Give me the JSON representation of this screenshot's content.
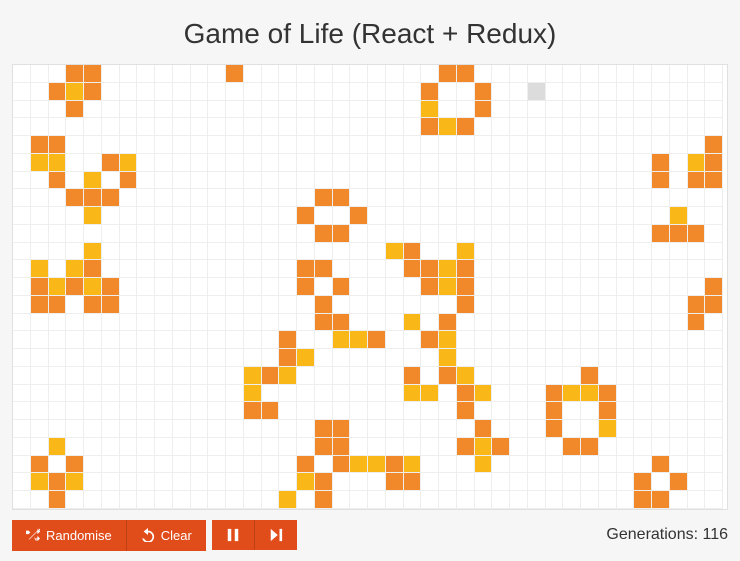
{
  "title": "Game of Life (React + Redux)",
  "controls": {
    "randomise_label": "Randomise",
    "clear_label": "Clear",
    "generations_label": "Generations:",
    "generations_value": 116
  },
  "grid": {
    "cols": 40,
    "rows": 25,
    "cell_size": 17.75,
    "cells": [
      {
        "r": 0,
        "c": 3,
        "s": "o"
      },
      {
        "r": 0,
        "c": 4,
        "s": "o"
      },
      {
        "r": 0,
        "c": 12,
        "s": "o"
      },
      {
        "r": 0,
        "c": 24,
        "s": "o"
      },
      {
        "r": 0,
        "c": 25,
        "s": "o"
      },
      {
        "r": 1,
        "c": 2,
        "s": "o"
      },
      {
        "r": 1,
        "c": 3,
        "s": "y"
      },
      {
        "r": 1,
        "c": 4,
        "s": "o"
      },
      {
        "r": 1,
        "c": 23,
        "s": "o"
      },
      {
        "r": 1,
        "c": 26,
        "s": "o"
      },
      {
        "r": 1,
        "c": 29,
        "s": "g"
      },
      {
        "r": 2,
        "c": 3,
        "s": "o"
      },
      {
        "r": 2,
        "c": 23,
        "s": "y"
      },
      {
        "r": 2,
        "c": 26,
        "s": "o"
      },
      {
        "r": 3,
        "c": 23,
        "s": "o"
      },
      {
        "r": 3,
        "c": 24,
        "s": "y"
      },
      {
        "r": 3,
        "c": 25,
        "s": "o"
      },
      {
        "r": 4,
        "c": 1,
        "s": "o"
      },
      {
        "r": 4,
        "c": 2,
        "s": "o"
      },
      {
        "r": 4,
        "c": 39,
        "s": "o"
      },
      {
        "r": 5,
        "c": 1,
        "s": "y"
      },
      {
        "r": 5,
        "c": 2,
        "s": "y"
      },
      {
        "r": 5,
        "c": 5,
        "s": "o"
      },
      {
        "r": 5,
        "c": 6,
        "s": "y"
      },
      {
        "r": 5,
        "c": 36,
        "s": "o"
      },
      {
        "r": 5,
        "c": 38,
        "s": "y"
      },
      {
        "r": 5,
        "c": 39,
        "s": "o"
      },
      {
        "r": 6,
        "c": 2,
        "s": "o"
      },
      {
        "r": 6,
        "c": 4,
        "s": "y"
      },
      {
        "r": 6,
        "c": 6,
        "s": "o"
      },
      {
        "r": 6,
        "c": 36,
        "s": "o"
      },
      {
        "r": 6,
        "c": 38,
        "s": "o"
      },
      {
        "r": 6,
        "c": 39,
        "s": "o"
      },
      {
        "r": 7,
        "c": 3,
        "s": "o"
      },
      {
        "r": 7,
        "c": 4,
        "s": "o"
      },
      {
        "r": 7,
        "c": 5,
        "s": "o"
      },
      {
        "r": 7,
        "c": 17,
        "s": "o"
      },
      {
        "r": 7,
        "c": 18,
        "s": "o"
      },
      {
        "r": 8,
        "c": 4,
        "s": "y"
      },
      {
        "r": 8,
        "c": 16,
        "s": "o"
      },
      {
        "r": 8,
        "c": 19,
        "s": "o"
      },
      {
        "r": 8,
        "c": 37,
        "s": "y"
      },
      {
        "r": 9,
        "c": 17,
        "s": "o"
      },
      {
        "r": 9,
        "c": 18,
        "s": "o"
      },
      {
        "r": 9,
        "c": 36,
        "s": "o"
      },
      {
        "r": 9,
        "c": 37,
        "s": "o"
      },
      {
        "r": 9,
        "c": 38,
        "s": "o"
      },
      {
        "r": 10,
        "c": 4,
        "s": "y"
      },
      {
        "r": 10,
        "c": 21,
        "s": "y"
      },
      {
        "r": 10,
        "c": 22,
        "s": "o"
      },
      {
        "r": 10,
        "c": 25,
        "s": "y"
      },
      {
        "r": 11,
        "c": 1,
        "s": "y"
      },
      {
        "r": 11,
        "c": 3,
        "s": "y"
      },
      {
        "r": 11,
        "c": 4,
        "s": "o"
      },
      {
        "r": 11,
        "c": 16,
        "s": "o"
      },
      {
        "r": 11,
        "c": 17,
        "s": "o"
      },
      {
        "r": 11,
        "c": 22,
        "s": "o"
      },
      {
        "r": 11,
        "c": 23,
        "s": "o"
      },
      {
        "r": 11,
        "c": 24,
        "s": "y"
      },
      {
        "r": 11,
        "c": 25,
        "s": "o"
      },
      {
        "r": 12,
        "c": 1,
        "s": "o"
      },
      {
        "r": 12,
        "c": 2,
        "s": "y"
      },
      {
        "r": 12,
        "c": 3,
        "s": "o"
      },
      {
        "r": 12,
        "c": 4,
        "s": "y"
      },
      {
        "r": 12,
        "c": 5,
        "s": "o"
      },
      {
        "r": 12,
        "c": 16,
        "s": "o"
      },
      {
        "r": 12,
        "c": 18,
        "s": "o"
      },
      {
        "r": 12,
        "c": 23,
        "s": "o"
      },
      {
        "r": 12,
        "c": 24,
        "s": "y"
      },
      {
        "r": 12,
        "c": 25,
        "s": "o"
      },
      {
        "r": 12,
        "c": 39,
        "s": "o"
      },
      {
        "r": 13,
        "c": 1,
        "s": "o"
      },
      {
        "r": 13,
        "c": 2,
        "s": "o"
      },
      {
        "r": 13,
        "c": 4,
        "s": "o"
      },
      {
        "r": 13,
        "c": 5,
        "s": "o"
      },
      {
        "r": 13,
        "c": 17,
        "s": "o"
      },
      {
        "r": 13,
        "c": 25,
        "s": "o"
      },
      {
        "r": 13,
        "c": 38,
        "s": "o"
      },
      {
        "r": 13,
        "c": 39,
        "s": "o"
      },
      {
        "r": 14,
        "c": 17,
        "s": "o"
      },
      {
        "r": 14,
        "c": 18,
        "s": "o"
      },
      {
        "r": 14,
        "c": 22,
        "s": "y"
      },
      {
        "r": 14,
        "c": 24,
        "s": "o"
      },
      {
        "r": 14,
        "c": 38,
        "s": "o"
      },
      {
        "r": 15,
        "c": 15,
        "s": "o"
      },
      {
        "r": 15,
        "c": 18,
        "s": "y"
      },
      {
        "r": 15,
        "c": 19,
        "s": "y"
      },
      {
        "r": 15,
        "c": 20,
        "s": "o"
      },
      {
        "r": 15,
        "c": 23,
        "s": "o"
      },
      {
        "r": 15,
        "c": 24,
        "s": "y"
      },
      {
        "r": 16,
        "c": 15,
        "s": "o"
      },
      {
        "r": 16,
        "c": 16,
        "s": "y"
      },
      {
        "r": 16,
        "c": 24,
        "s": "y"
      },
      {
        "r": 17,
        "c": 13,
        "s": "y"
      },
      {
        "r": 17,
        "c": 14,
        "s": "o"
      },
      {
        "r": 17,
        "c": 15,
        "s": "y"
      },
      {
        "r": 17,
        "c": 22,
        "s": "o"
      },
      {
        "r": 17,
        "c": 24,
        "s": "o"
      },
      {
        "r": 17,
        "c": 25,
        "s": "y"
      },
      {
        "r": 17,
        "c": 32,
        "s": "o"
      },
      {
        "r": 18,
        "c": 13,
        "s": "y"
      },
      {
        "r": 18,
        "c": 22,
        "s": "y"
      },
      {
        "r": 18,
        "c": 23,
        "s": "y"
      },
      {
        "r": 18,
        "c": 25,
        "s": "o"
      },
      {
        "r": 18,
        "c": 26,
        "s": "y"
      },
      {
        "r": 18,
        "c": 30,
        "s": "o"
      },
      {
        "r": 18,
        "c": 31,
        "s": "y"
      },
      {
        "r": 18,
        "c": 32,
        "s": "y"
      },
      {
        "r": 18,
        "c": 33,
        "s": "o"
      },
      {
        "r": 19,
        "c": 13,
        "s": "o"
      },
      {
        "r": 19,
        "c": 14,
        "s": "o"
      },
      {
        "r": 19,
        "c": 25,
        "s": "o"
      },
      {
        "r": 19,
        "c": 30,
        "s": "o"
      },
      {
        "r": 19,
        "c": 33,
        "s": "o"
      },
      {
        "r": 20,
        "c": 17,
        "s": "o"
      },
      {
        "r": 20,
        "c": 18,
        "s": "o"
      },
      {
        "r": 20,
        "c": 26,
        "s": "o"
      },
      {
        "r": 20,
        "c": 30,
        "s": "o"
      },
      {
        "r": 20,
        "c": 33,
        "s": "y"
      },
      {
        "r": 21,
        "c": 2,
        "s": "y"
      },
      {
        "r": 21,
        "c": 17,
        "s": "o"
      },
      {
        "r": 21,
        "c": 18,
        "s": "o"
      },
      {
        "r": 21,
        "c": 25,
        "s": "o"
      },
      {
        "r": 21,
        "c": 26,
        "s": "y"
      },
      {
        "r": 21,
        "c": 27,
        "s": "o"
      },
      {
        "r": 21,
        "c": 31,
        "s": "o"
      },
      {
        "r": 21,
        "c": 32,
        "s": "o"
      },
      {
        "r": 22,
        "c": 1,
        "s": "o"
      },
      {
        "r": 22,
        "c": 3,
        "s": "o"
      },
      {
        "r": 22,
        "c": 16,
        "s": "o"
      },
      {
        "r": 22,
        "c": 18,
        "s": "o"
      },
      {
        "r": 22,
        "c": 19,
        "s": "y"
      },
      {
        "r": 22,
        "c": 20,
        "s": "y"
      },
      {
        "r": 22,
        "c": 21,
        "s": "o"
      },
      {
        "r": 22,
        "c": 22,
        "s": "y"
      },
      {
        "r": 22,
        "c": 26,
        "s": "y"
      },
      {
        "r": 22,
        "c": 36,
        "s": "o"
      },
      {
        "r": 23,
        "c": 1,
        "s": "y"
      },
      {
        "r": 23,
        "c": 2,
        "s": "o"
      },
      {
        "r": 23,
        "c": 3,
        "s": "y"
      },
      {
        "r": 23,
        "c": 16,
        "s": "y"
      },
      {
        "r": 23,
        "c": 17,
        "s": "o"
      },
      {
        "r": 23,
        "c": 21,
        "s": "o"
      },
      {
        "r": 23,
        "c": 22,
        "s": "o"
      },
      {
        "r": 23,
        "c": 35,
        "s": "o"
      },
      {
        "r": 23,
        "c": 37,
        "s": "o"
      },
      {
        "r": 24,
        "c": 2,
        "s": "o"
      },
      {
        "r": 24,
        "c": 15,
        "s": "y"
      },
      {
        "r": 24,
        "c": 17,
        "s": "o"
      },
      {
        "r": 24,
        "c": 35,
        "s": "o"
      },
      {
        "r": 24,
        "c": 36,
        "s": "o"
      }
    ]
  }
}
